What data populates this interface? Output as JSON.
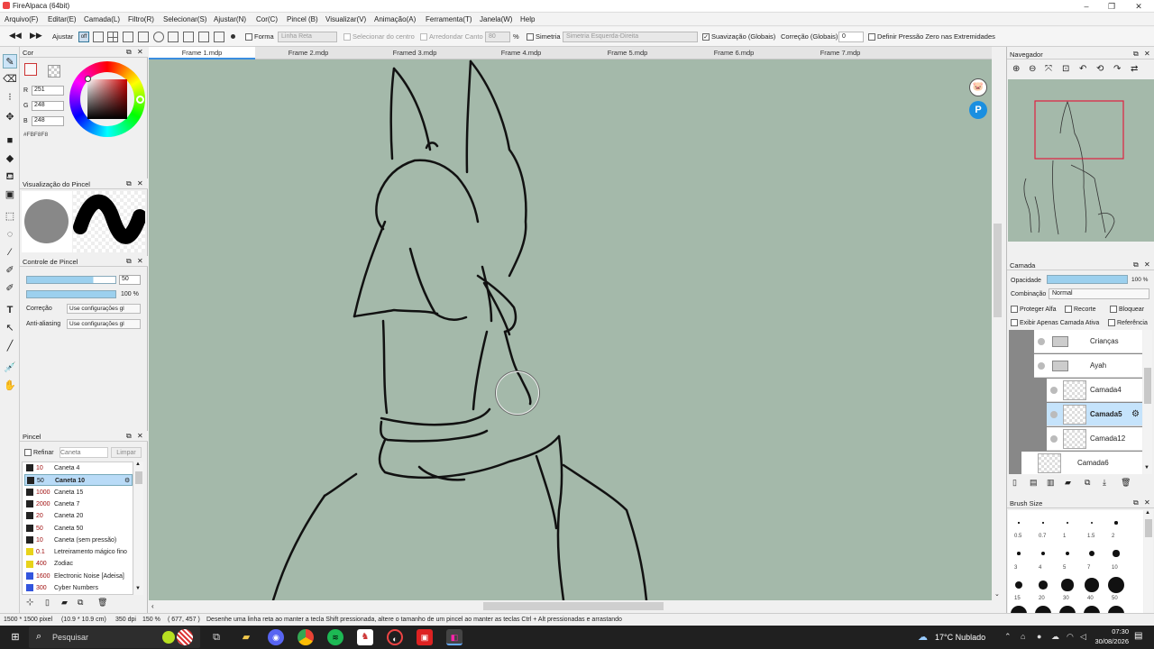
{
  "window": {
    "title": "FireAlpaca (64bit)"
  },
  "menu": [
    "Arquivo(F)",
    "Editar(E)",
    "Camada(L)",
    "Filtro(R)",
    "Selecionar(S)",
    "Ajustar(N)",
    "Cor(C)",
    "Pincel (B)",
    "Visualizar(V)",
    "Animação(A)",
    "Ferramenta(T)",
    "Janela(W)",
    "Help"
  ],
  "toolbar": {
    "ajustar": "Ajustar",
    "off": "off",
    "forma": "Forma",
    "forma_value": "Linha Reta",
    "selecionar_centro": "Selecionar do centro",
    "arredondar_canto": "Arredondar Canto",
    "arredondar_value": "80",
    "percent": "%",
    "simetria": "Simetria",
    "simetria_value": "Simetria Esquerda-Direita",
    "suavizacao": "Suavização (Globais)",
    "correcao": "Correção (Globais)",
    "correcao_value": "0",
    "pressao_zero": "Definir Pressão Zero nas Extremidades"
  },
  "color_panel": {
    "title": "Cor",
    "r_label": "R",
    "r": "251",
    "g_label": "G",
    "g": "248",
    "b_label": "B",
    "b": "248",
    "hex": "#FBF8F8"
  },
  "preview_panel": {
    "title": "Visualização do Pincel"
  },
  "brush_control": {
    "title": "Controle de Pincel",
    "size": "50",
    "opacity": "100 %",
    "correcao_label": "Correção",
    "correcao_value": "Use configurações gl",
    "aa_label": "Anti-aliasing",
    "aa_value": "Use configurações gl"
  },
  "brush_panel": {
    "title": "Pincel",
    "refinar": "Refinar",
    "search_placeholder": "Caneta",
    "limpar": "Limpar",
    "items": [
      {
        "size": "10",
        "name": "Caneta 4",
        "color": "#222222"
      },
      {
        "size": "50",
        "name": "Caneta 10",
        "color": "#222222"
      },
      {
        "size": "1000",
        "name": "Caneta 15",
        "color": "#222222"
      },
      {
        "size": "2000",
        "name": "Caneta 7",
        "color": "#222222"
      },
      {
        "size": "20",
        "name": "Caneta 20",
        "color": "#222222"
      },
      {
        "size": "50",
        "name": "Caneta 50",
        "color": "#222222"
      },
      {
        "size": "10",
        "name": "Caneta (sem pressão)",
        "color": "#222222"
      },
      {
        "size": "0.1",
        "name": "Letreiramento mágico fino",
        "color": "#e8d31a"
      },
      {
        "size": "400",
        "name": "Zodiac",
        "color": "#e8d31a"
      },
      {
        "size": "1600",
        "name": "Electronic Noise [Adeisa]",
        "color": "#3355dd"
      },
      {
        "size": "300",
        "name": "Cyber Numbers",
        "color": "#3355dd"
      }
    ]
  },
  "tabs": [
    "Frame 1.mdp",
    "Frame 2.mdp",
    "Framed 3.mdp",
    "Frame 4.mdp",
    "Frame 5.mdp",
    "Frame 6.mdp",
    "Frame 7.mdp"
  ],
  "navigator": {
    "title": "Navegador"
  },
  "layer_panel": {
    "title": "Camada",
    "opacidade": "Opacidade",
    "opacity_value": "100 %",
    "combinacao": "Combinação",
    "blend": "Normal",
    "proteger_alfa": "Proteger Alfa",
    "recorte": "Recorte",
    "bloquear": "Bloquear",
    "exibir_apenas": "Exibir Apenas Camada Ativa",
    "referencia": "Referência",
    "layers": [
      "Crianças",
      "Ayah",
      "Camada4",
      "Camada5",
      "Camada12",
      "Camada6"
    ]
  },
  "brush_size_panel": {
    "title": "Brush Size",
    "row1": [
      "0.5",
      "0.7",
      "1",
      "1.5",
      "2"
    ],
    "row2": [
      "3",
      "4",
      "5",
      "7",
      "10"
    ],
    "row3": [
      "15",
      "20",
      "30",
      "40",
      "50"
    ]
  },
  "status": {
    "size": "1500 * 1500 pixel",
    "cm": "(10.9 * 10.9 cm)",
    "dpi": "350 dpi",
    "zoom": "150 %",
    "coords": "( 677, 457 )",
    "hint": "Desenhe uma linha reta ao manter a tecla Shift pressionada, altere o tamanho de um pincel ao manter as teclas Ctrl + Alt pressionadas e arrastando"
  },
  "taskbar": {
    "search": "Pesquisar",
    "weather": "17°C  Nublado",
    "time": "07:30",
    "date": "30/08/2026"
  }
}
